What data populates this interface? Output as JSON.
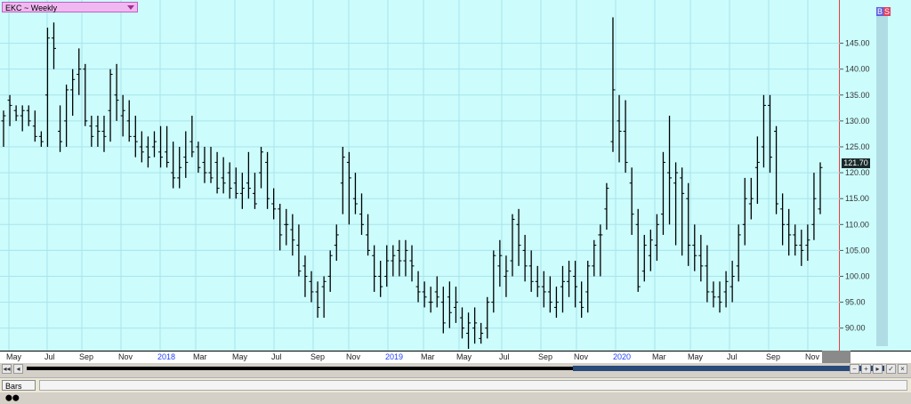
{
  "window": {
    "title": "EKC ~ Weekly"
  },
  "status_bar": {
    "tab_label": "Bars"
  },
  "badge": {
    "b": "B",
    "s": "S"
  },
  "last_price": "121.70",
  "chart_data": {
    "type": "ohlc",
    "title": "EKC ~ Weekly",
    "ylim": [
      86,
      153
    ],
    "yticks": [
      "145.00",
      "140.00",
      "135.00",
      "130.00",
      "125.00",
      "120.00",
      "115.00",
      "110.00",
      "105.00",
      "100.00",
      "95.00",
      "90.00"
    ],
    "time_labels": [
      {
        "label": "May",
        "year": false
      },
      {
        "label": "Jul",
        "year": false
      },
      {
        "label": "Sep",
        "year": false
      },
      {
        "label": "Nov",
        "year": false
      },
      {
        "label": "2018",
        "year": true
      },
      {
        "label": "Mar",
        "year": false
      },
      {
        "label": "May",
        "year": false
      },
      {
        "label": "Jul",
        "year": false
      },
      {
        "label": "Sep",
        "year": false
      },
      {
        "label": "Nov",
        "year": false
      },
      {
        "label": "2019",
        "year": true
      },
      {
        "label": "Mar",
        "year": false
      },
      {
        "label": "May",
        "year": false
      },
      {
        "label": "Jul",
        "year": false
      },
      {
        "label": "Sep",
        "year": false
      },
      {
        "label": "Nov",
        "year": false
      },
      {
        "label": "2020",
        "year": true
      },
      {
        "label": "Mar",
        "year": false
      },
      {
        "label": "May",
        "year": false
      },
      {
        "label": "Jul",
        "year": false
      },
      {
        "label": "Sep",
        "year": false
      },
      {
        "label": "Nov",
        "year": false
      }
    ],
    "bars": [
      [
        130,
        132,
        125,
        131
      ],
      [
        134,
        135,
        129,
        133
      ],
      [
        132,
        133,
        130,
        131
      ],
      [
        131,
        133,
        128,
        132
      ],
      [
        132,
        133,
        129,
        130
      ],
      [
        129,
        132,
        126,
        127
      ],
      [
        127,
        128,
        125,
        126
      ],
      [
        135,
        148,
        125,
        146
      ],
      [
        146,
        149,
        140,
        144
      ],
      [
        128,
        133,
        124,
        126
      ],
      [
        130,
        137,
        125,
        136
      ],
      [
        136,
        140,
        131,
        138
      ],
      [
        139,
        144,
        135,
        140
      ],
      [
        140,
        141,
        129,
        130
      ],
      [
        129,
        131,
        125,
        127
      ],
      [
        129,
        131,
        125,
        128
      ],
      [
        128,
        131,
        124,
        127
      ],
      [
        132,
        140,
        126,
        139
      ],
      [
        135,
        141,
        130,
        134
      ],
      [
        131,
        135,
        127,
        132
      ],
      [
        130,
        134,
        126,
        127
      ],
      [
        127,
        131,
        123,
        126
      ],
      [
        125,
        128,
        122,
        124
      ],
      [
        125,
        127,
        121,
        123
      ],
      [
        125,
        128,
        123,
        126
      ],
      [
        124,
        129,
        121,
        123
      ],
      [
        124,
        129,
        121,
        122
      ],
      [
        120,
        126,
        117,
        119
      ],
      [
        119,
        125,
        117,
        121
      ],
      [
        123,
        128,
        119,
        122
      ],
      [
        126,
        131,
        123,
        124
      ],
      [
        125,
        126,
        120,
        121
      ],
      [
        122,
        125,
        118,
        120
      ],
      [
        120,
        125,
        118,
        119
      ],
      [
        122,
        124,
        116,
        117
      ],
      [
        119,
        123,
        116,
        118
      ],
      [
        120,
        122,
        115,
        117
      ],
      [
        118,
        121,
        115,
        116
      ],
      [
        116,
        120,
        113,
        117
      ],
      [
        118,
        124,
        115,
        117
      ],
      [
        116,
        120,
        113,
        114
      ],
      [
        120,
        125,
        117,
        124
      ],
      [
        122,
        124,
        113,
        115
      ],
      [
        114,
        117,
        111,
        113
      ],
      [
        113,
        114,
        105,
        108
      ],
      [
        110,
        113,
        106,
        110
      ],
      [
        109,
        112,
        104,
        107
      ],
      [
        106,
        110,
        100,
        101
      ],
      [
        102,
        104,
        96,
        100
      ],
      [
        99,
        101,
        95,
        97
      ],
      [
        97,
        99,
        92,
        94
      ],
      [
        98,
        100,
        92,
        99
      ],
      [
        100,
        105,
        97,
        104
      ],
      [
        106,
        110,
        103,
        108
      ],
      [
        118,
        125,
        112,
        123
      ],
      [
        122,
        124,
        110,
        119
      ],
      [
        115,
        120,
        112,
        114
      ],
      [
        112,
        116,
        108,
        110
      ],
      [
        108,
        112,
        104,
        105
      ],
      [
        104,
        106,
        97,
        100
      ],
      [
        100,
        103,
        96,
        98
      ],
      [
        100,
        106,
        98,
        103
      ],
      [
        103,
        106,
        100,
        104
      ],
      [
        105,
        107,
        100,
        103
      ],
      [
        103,
        107,
        100,
        105
      ],
      [
        103,
        106,
        99,
        102
      ],
      [
        98,
        101,
        95,
        97
      ],
      [
        97,
        99,
        94,
        96
      ],
      [
        95,
        98,
        93,
        95
      ],
      [
        97,
        100,
        94,
        96
      ],
      [
        95,
        98,
        89,
        91
      ],
      [
        96,
        99,
        90,
        93
      ],
      [
        94,
        98,
        91,
        95
      ],
      [
        92,
        94,
        88,
        90
      ],
      [
        89,
        93,
        86,
        91
      ],
      [
        90,
        94,
        87,
        91
      ],
      [
        88,
        91,
        87,
        89
      ],
      [
        90,
        96,
        88,
        95
      ],
      [
        95,
        105,
        93,
        104
      ],
      [
        102,
        107,
        98,
        104
      ],
      [
        100,
        104,
        96,
        101
      ],
      [
        103,
        112,
        100,
        111
      ],
      [
        110,
        113,
        102,
        106
      ],
      [
        105,
        108,
        99,
        102
      ],
      [
        102,
        105,
        97,
        99
      ],
      [
        99,
        102,
        96,
        98
      ],
      [
        98,
        101,
        94,
        97
      ],
      [
        97,
        100,
        93,
        95
      ],
      [
        94,
        98,
        92,
        95
      ],
      [
        98,
        102,
        93,
        99
      ],
      [
        99,
        103,
        96,
        101
      ],
      [
        100,
        103,
        94,
        98
      ],
      [
        95,
        99,
        92,
        94
      ],
      [
        97,
        103,
        93,
        102
      ],
      [
        102,
        107,
        100,
        106
      ],
      [
        108,
        110,
        100,
        108
      ],
      [
        113,
        118,
        109,
        117
      ],
      [
        126,
        150,
        124,
        136
      ],
      [
        130,
        135,
        122,
        128
      ],
      [
        128,
        134,
        120,
        122
      ],
      [
        118,
        121,
        108,
        112
      ],
      [
        110,
        113,
        97,
        98
      ],
      [
        101,
        108,
        99,
        106
      ],
      [
        104,
        109,
        101,
        107
      ],
      [
        106,
        112,
        103,
        110
      ],
      [
        112,
        124,
        108,
        122
      ],
      [
        120,
        131,
        110,
        119
      ],
      [
        118,
        122,
        106,
        120
      ],
      [
        119,
        121,
        104,
        116
      ],
      [
        115,
        118,
        102,
        106
      ],
      [
        106,
        110,
        101,
        104
      ],
      [
        104,
        108,
        99,
        102
      ],
      [
        102,
        106,
        95,
        97
      ],
      [
        97,
        99,
        94,
        96
      ],
      [
        96,
        99,
        93,
        95
      ],
      [
        97,
        101,
        94,
        99
      ],
      [
        98,
        103,
        95,
        100
      ],
      [
        102,
        110,
        99,
        108
      ],
      [
        110,
        119,
        106,
        115
      ],
      [
        114,
        119,
        111,
        115
      ],
      [
        121,
        127,
        114,
        122
      ],
      [
        125,
        135,
        121,
        133
      ],
      [
        133,
        135,
        120,
        123
      ],
      [
        128,
        129,
        112,
        114
      ],
      [
        113,
        116,
        106,
        110
      ],
      [
        110,
        113,
        104,
        108
      ],
      [
        108,
        110,
        104,
        106
      ],
      [
        106,
        109,
        102,
        105
      ],
      [
        106,
        110,
        103,
        107
      ],
      [
        110,
        120,
        107,
        115
      ],
      [
        113,
        122,
        112,
        121
      ]
    ]
  }
}
